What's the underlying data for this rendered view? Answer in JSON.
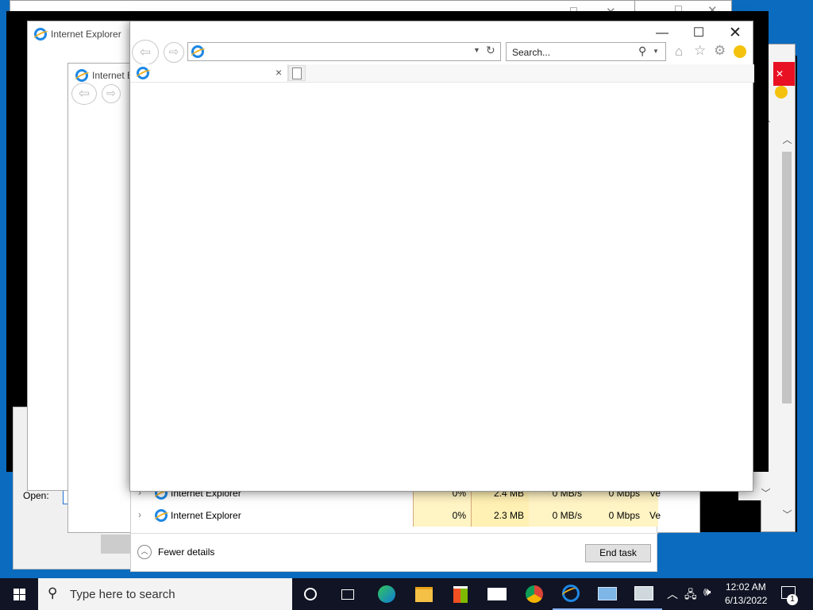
{
  "windows": {
    "bg_ie_back": {
      "title": "Internet Explorer"
    },
    "bg_ie_mid": {
      "title": "Internet E"
    },
    "run_dialog": {
      "open_label": "Open:"
    }
  },
  "ie_front": {
    "address_value": "",
    "search_placeholder": "Search...",
    "tab_close": "×"
  },
  "task_manager": {
    "rows": [
      {
        "name": "Internet Explorer",
        "cpu": "0%",
        "memory": "2.4 MB",
        "disk": "0 MB/s",
        "network": "0 Mbps",
        "extra": "Ve"
      },
      {
        "name": "Internet Explorer",
        "cpu": "0%",
        "memory": "2.3 MB",
        "disk": "0 MB/s",
        "network": "0 Mbps",
        "extra": "Ve"
      }
    ],
    "fewer_details": "Fewer details",
    "end_task": "End task"
  },
  "taskbar": {
    "search_placeholder": "Type here to search",
    "time": "12:02 AM",
    "date": "6/13/2022",
    "notification_count": "1"
  }
}
